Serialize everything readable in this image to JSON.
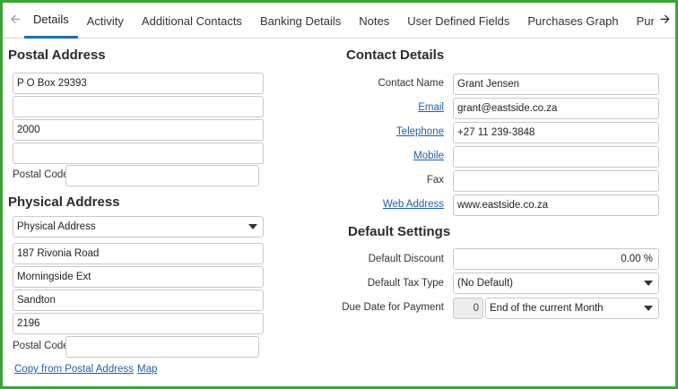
{
  "tabs": [
    "Details",
    "Activity",
    "Additional Contacts",
    "Banking Details",
    "Notes",
    "User Defined Fields",
    "Purchases Graph",
    "Purchase O"
  ],
  "active_tab": 0,
  "postal": {
    "title": "Postal Address",
    "line1": "P O Box 29393",
    "line2": "",
    "line3": "2000",
    "line4": "",
    "postal_code_label": "Postal Code",
    "postal_code": ""
  },
  "physical": {
    "title": "Physical Address",
    "type_selected": "Physical Address",
    "line1": "187 Rivonia Road",
    "line2": "Morningside Ext",
    "line3": "Sandton",
    "line4": "2196",
    "postal_code_label": "Postal Code",
    "postal_code": "",
    "copy_link": "Copy from Postal Address",
    "map_link": "Map"
  },
  "contact": {
    "title": "Contact Details",
    "name_label": "Contact Name",
    "name": "Grant Jensen",
    "email_label": "Email",
    "email": "grant@eastside.co.za",
    "telephone_label": "Telephone",
    "telephone": "+27 11 239-3848",
    "mobile_label": "Mobile",
    "mobile": "",
    "fax_label": "Fax",
    "fax": "",
    "web_label": "Web Address",
    "web": "www.eastside.co.za"
  },
  "defaults": {
    "title": "Default Settings",
    "discount_label": "Default Discount",
    "discount": "0.00 %",
    "tax_label": "Default Tax Type",
    "tax": "(No Default)",
    "due_label": "Due Date for Payment",
    "due_days": "0",
    "due_option": "End of the current Month"
  },
  "icons": {
    "left_arrow": "arrow-left-icon",
    "right_arrow": "arrow-right-icon"
  },
  "colors": {
    "frame": "#3aa43a",
    "active_tab_underline": "#1f6fb5",
    "link": "#1f5fa8"
  }
}
